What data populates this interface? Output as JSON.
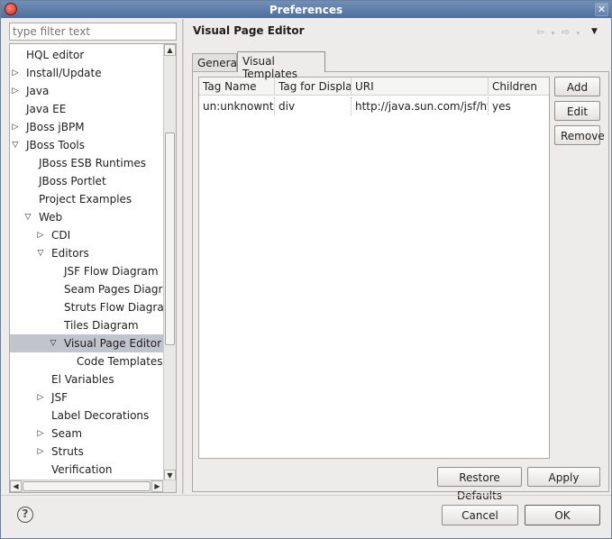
{
  "window": {
    "title": "Preferences",
    "close_glyph": "✕"
  },
  "filter": {
    "placeholder": "type filter text"
  },
  "tree": {
    "items": [
      {
        "label": "HQL editor",
        "arrow": ""
      },
      {
        "label": "Install/Update",
        "arrow": "▷"
      },
      {
        "label": "Java",
        "arrow": "▷"
      },
      {
        "label": "Java EE",
        "arrow": ""
      },
      {
        "label": "JBoss jBPM",
        "arrow": "▷"
      },
      {
        "label": "JBoss Tools",
        "arrow": "▽"
      },
      {
        "label": "JBoss ESB Runtimes",
        "arrow": ""
      },
      {
        "label": "JBoss Portlet",
        "arrow": ""
      },
      {
        "label": "Project Examples",
        "arrow": ""
      },
      {
        "label": "Web",
        "arrow": "▽"
      },
      {
        "label": "CDI",
        "arrow": "▷"
      },
      {
        "label": "Editors",
        "arrow": "▽"
      },
      {
        "label": "JSF Flow Diagram",
        "arrow": ""
      },
      {
        "label": "Seam Pages Diagram",
        "arrow": ""
      },
      {
        "label": "Struts Flow Diagram",
        "arrow": ""
      },
      {
        "label": "Tiles Diagram",
        "arrow": ""
      },
      {
        "label": "Visual Page Editor",
        "arrow": "▽"
      },
      {
        "label": "Code Templates",
        "arrow": ""
      },
      {
        "label": "El Variables",
        "arrow": ""
      },
      {
        "label": "JSF",
        "arrow": "▷"
      },
      {
        "label": "Label Decorations",
        "arrow": ""
      },
      {
        "label": "Seam",
        "arrow": "▷"
      },
      {
        "label": "Struts",
        "arrow": "▷"
      },
      {
        "label": "Verification",
        "arrow": ""
      }
    ]
  },
  "page": {
    "title": "Visual Page Editor",
    "nav_back": "⇦",
    "nav_forward": "⇨",
    "menu_glyph": "▼"
  },
  "tabs": [
    {
      "label": "General"
    },
    {
      "label": "Visual Templates"
    }
  ],
  "table": {
    "columns": [
      "Tag Name",
      "Tag for Display",
      "URI",
      "Children"
    ],
    "rows": [
      [
        "un:unknowntag",
        "div",
        "http://java.sun.com/jsf/html",
        "yes"
      ]
    ]
  },
  "buttons": {
    "add": "Add",
    "edit": "Edit",
    "remove": "Remove",
    "restore_defaults": "Restore Defaults",
    "apply": "Apply",
    "cancel": "Cancel",
    "ok": "OK"
  },
  "help": {
    "glyph": "?"
  }
}
